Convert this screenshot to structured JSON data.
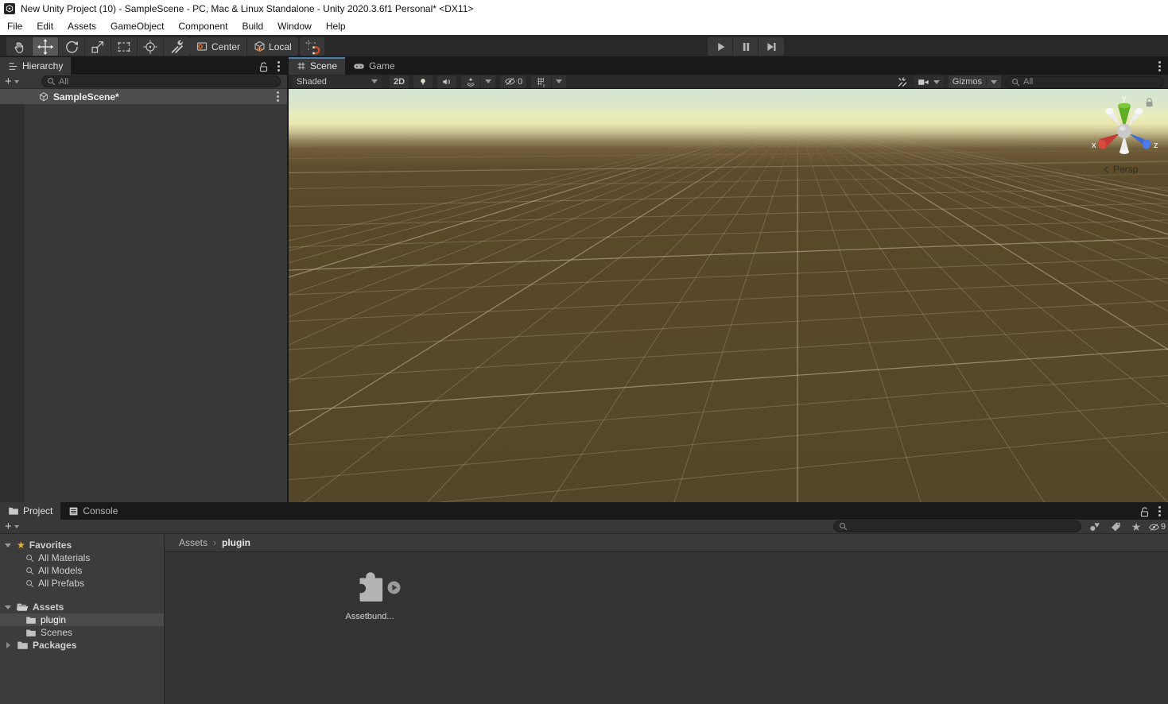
{
  "window": {
    "title": "New Unity Project (10) - SampleScene - PC, Mac & Linux Standalone - Unity 2020.3.6f1 Personal* <DX11>"
  },
  "menu": {
    "items": [
      "File",
      "Edit",
      "Assets",
      "GameObject",
      "Component",
      "Build",
      "Window",
      "Help"
    ]
  },
  "toolbar": {
    "center_label": "Center",
    "local_label": "Local"
  },
  "hierarchy": {
    "tab_label": "Hierarchy",
    "search_value": "All",
    "scene_name": "SampleScene*"
  },
  "scene_view": {
    "tab_scene": "Scene",
    "tab_game": "Game",
    "shading_mode": "Shaded",
    "btn_2d": "2D",
    "hidden_count": "0",
    "gizmos_label": "Gizmos",
    "search_value": "All",
    "persp_label": "Persp",
    "axis_labels": {
      "x": "x",
      "y": "y",
      "z": "z"
    }
  },
  "project": {
    "tab_project": "Project",
    "tab_console": "Console",
    "favorites": {
      "label": "Favorites",
      "items": [
        "All Materials",
        "All Models",
        "All Prefabs"
      ]
    },
    "assets": {
      "label": "Assets",
      "children": [
        "plugin",
        "Scenes"
      ]
    },
    "packages_label": "Packages",
    "selected_folder": "plugin",
    "breadcrumb": [
      "Assets",
      "plugin"
    ],
    "asset_item_label": "Assetbund...",
    "hidden_count": "9"
  },
  "colors": {
    "accent_blue": "#4c7baf",
    "snap_orange": "#c4502e",
    "pivot_orange": "#d66b2a",
    "favorite_yellow": "#e3b33a",
    "axis_x_red": "#c13b32",
    "axis_y_green": "#6fba2c",
    "axis_z_blue": "#3d6bd6",
    "sky_top": "#d3e3d3",
    "sky_horizon": "#eaecbc",
    "ground_brown": "#574729",
    "grid_line": "#cfc4ab"
  }
}
